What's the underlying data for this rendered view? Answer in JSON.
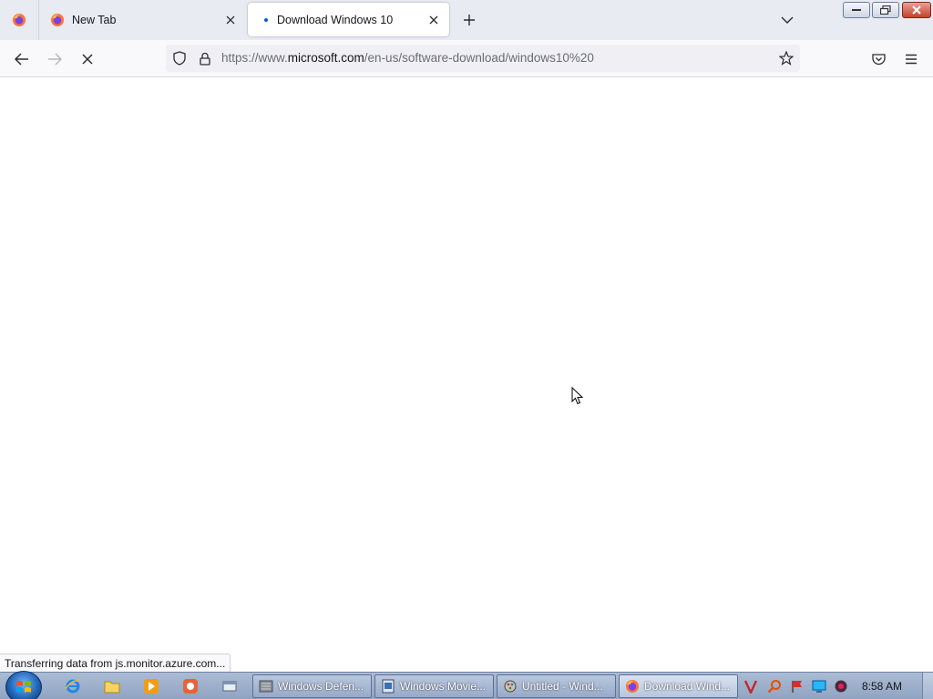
{
  "browser": {
    "tabs": [
      {
        "title": "New Tab",
        "active": false
      },
      {
        "title": "Download Windows 10",
        "active": true,
        "loading": true
      }
    ],
    "url": {
      "scheme": "https://www.",
      "host": "microsoft.com",
      "path": "/en-us/software-download/windows10%20"
    },
    "status_text": "Transferring data from js.monitor.azure.com..."
  },
  "taskbar": {
    "tasks": [
      {
        "label": "Windows Defen...",
        "icon": "defender-icon"
      },
      {
        "label": "Windows Movie...",
        "icon": "movie-maker-icon"
      },
      {
        "label": "Untitled - Wind...",
        "icon": "paint-icon"
      },
      {
        "label": "Download Wind...",
        "icon": "firefox-icon",
        "active": true
      }
    ],
    "clock": "8:58 AM"
  },
  "colors": {
    "accent": "#0060df",
    "tab_strip": "#e8ebf2",
    "taskbar": "#9fb1cc"
  }
}
